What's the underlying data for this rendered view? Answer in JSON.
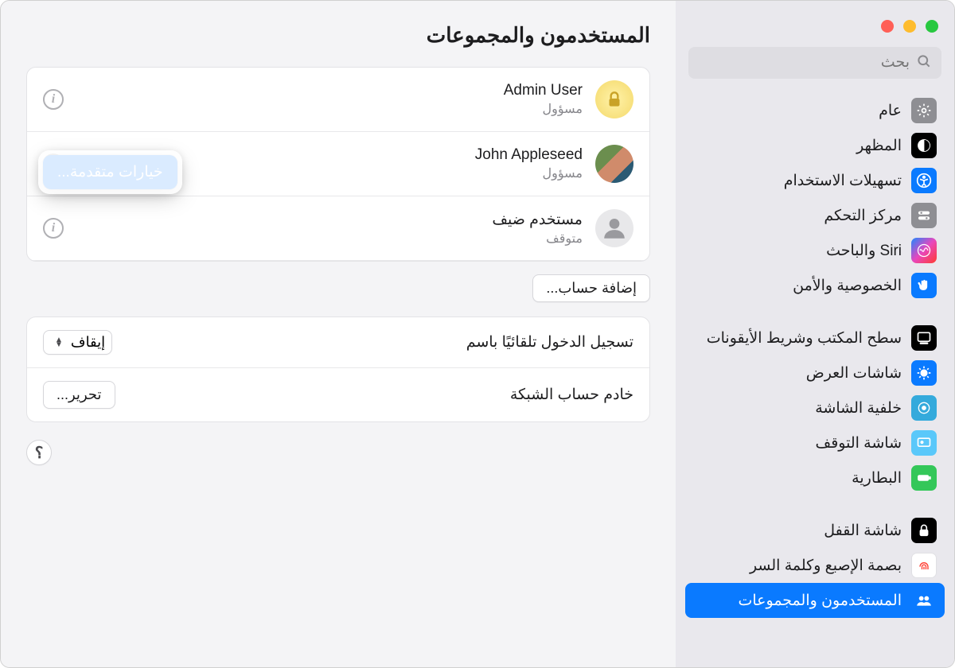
{
  "search": {
    "placeholder": "بحث"
  },
  "sidebar": {
    "groups": [
      {
        "items": [
          {
            "label": "عام",
            "icon": "gear-icon",
            "bg": "#8e8e93",
            "fg": "#fff"
          },
          {
            "label": "المظهر",
            "icon": "appearance-icon",
            "bg": "#000",
            "fg": "#fff"
          },
          {
            "label": "تسهيلات الاستخدام",
            "icon": "accessibility-icon",
            "bg": "#0a7aff",
            "fg": "#fff"
          },
          {
            "label": "مركز التحكم",
            "icon": "control-center-icon",
            "bg": "#8e8e93",
            "fg": "#fff"
          },
          {
            "label": "Siri والباحث",
            "icon": "siri-icon",
            "bg": "linear-gradient(135deg,#1f87ff,#e847bd,#ff3b30)",
            "fg": "#fff"
          },
          {
            "label": "الخصوصية والأمن",
            "icon": "hand-icon",
            "bg": "#0a7aff",
            "fg": "#fff"
          }
        ]
      },
      {
        "items": [
          {
            "label": "سطح المكتب وشريط الأيقونات",
            "icon": "desktop-dock-icon",
            "bg": "#000",
            "fg": "#fff"
          },
          {
            "label": "شاشات العرض",
            "icon": "displays-icon",
            "bg": "#0a7aff",
            "fg": "#fff"
          },
          {
            "label": "خلفية الشاشة",
            "icon": "wallpaper-icon",
            "bg": "#34aadc",
            "fg": "#fff"
          },
          {
            "label": "شاشة التوقف",
            "icon": "screensaver-icon",
            "bg": "#5ac8fa",
            "fg": "#fff"
          },
          {
            "label": "البطارية",
            "icon": "battery-icon",
            "bg": "#34c759",
            "fg": "#fff"
          }
        ]
      },
      {
        "items": [
          {
            "label": "شاشة القفل",
            "icon": "lock-screen-icon",
            "bg": "#000",
            "fg": "#fff"
          },
          {
            "label": "بصمة الإصبع وكلمة السر",
            "icon": "touchid-icon",
            "bg": "#fff",
            "fg": "#ff3b30"
          },
          {
            "label": "المستخدمون والمجموعات",
            "icon": "users-groups-icon",
            "bg": "#0a7aff",
            "fg": "#fff",
            "selected": true
          }
        ]
      }
    ]
  },
  "main": {
    "title": "المستخدمون والمجموعات",
    "users": [
      {
        "name": "Admin User",
        "role": "مسؤول",
        "avatar": "lock"
      },
      {
        "name": "John Appleseed",
        "role": "مسؤول",
        "avatar": "photo"
      },
      {
        "name": "مستخدم ضيف",
        "role": "متوقف",
        "avatar": "guest"
      }
    ],
    "popover_label": "خيارات متقدمة...",
    "add_account_label": "إضافة حساب...",
    "settings": [
      {
        "label": "تسجيل الدخول تلقائيًا باسم",
        "control": "select",
        "value": "إيقاف"
      },
      {
        "label": "خادم حساب الشبكة",
        "control": "button",
        "value": "تحرير..."
      }
    ],
    "help_label": "؟"
  }
}
